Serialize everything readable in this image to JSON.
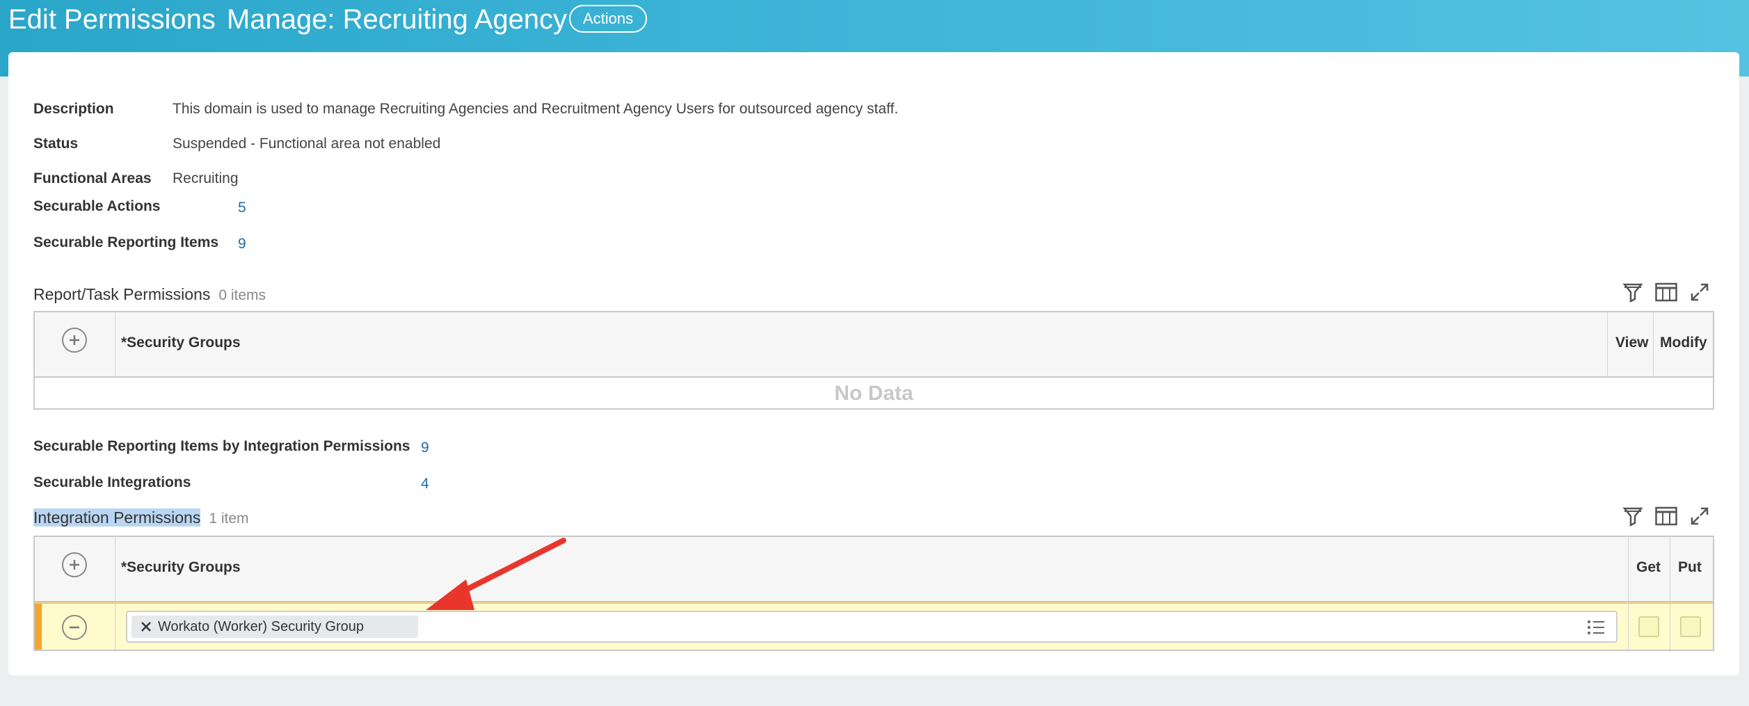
{
  "header": {
    "title_part1": "Edit Permissions",
    "title_part2": "Manage: Recruiting Agency",
    "actions_label": "Actions"
  },
  "fields": {
    "description_label": "Description",
    "description_value": "This domain is used to manage Recruiting Agencies and Recruitment Agency Users for outsourced agency staff.",
    "status_label": "Status",
    "status_value": "Suspended - Functional area not enabled",
    "functional_areas_label": "Functional Areas",
    "functional_areas_value": "Recruiting",
    "securable_actions_label": "Securable Actions",
    "securable_actions_value": "5",
    "securable_reporting_items_label": "Securable Reporting Items",
    "securable_reporting_items_value": "9",
    "securable_reporting_items_integration_label": "Securable Reporting Items by Integration Permissions",
    "securable_reporting_items_integration_value": "9",
    "securable_integrations_label": "Securable Integrations",
    "securable_integrations_value": "4"
  },
  "report_task": {
    "title": "Report/Task Permissions",
    "count": "0 items",
    "col_security_groups": "*Security Groups",
    "col_view": "View",
    "col_modify": "Modify",
    "empty_text": "No Data"
  },
  "integration": {
    "title": "Integration Permissions",
    "count": "1 item",
    "col_security_groups": "*Security Groups",
    "col_get": "Get",
    "col_put": "Put",
    "row_group": "Workato (Worker) Security Group"
  },
  "icons": [
    "filter-icon",
    "columns-icon",
    "expand-icon",
    "add-row-icon",
    "remove-row-icon",
    "clear-icon",
    "list-icon",
    "arrow-annotation"
  ],
  "colors": {
    "header_start": "#2aa6c9",
    "link": "#1f6aa5",
    "row_highlight": "#fffbcc",
    "row_accent": "#f6a432",
    "annotation_arrow": "#e8362c"
  }
}
